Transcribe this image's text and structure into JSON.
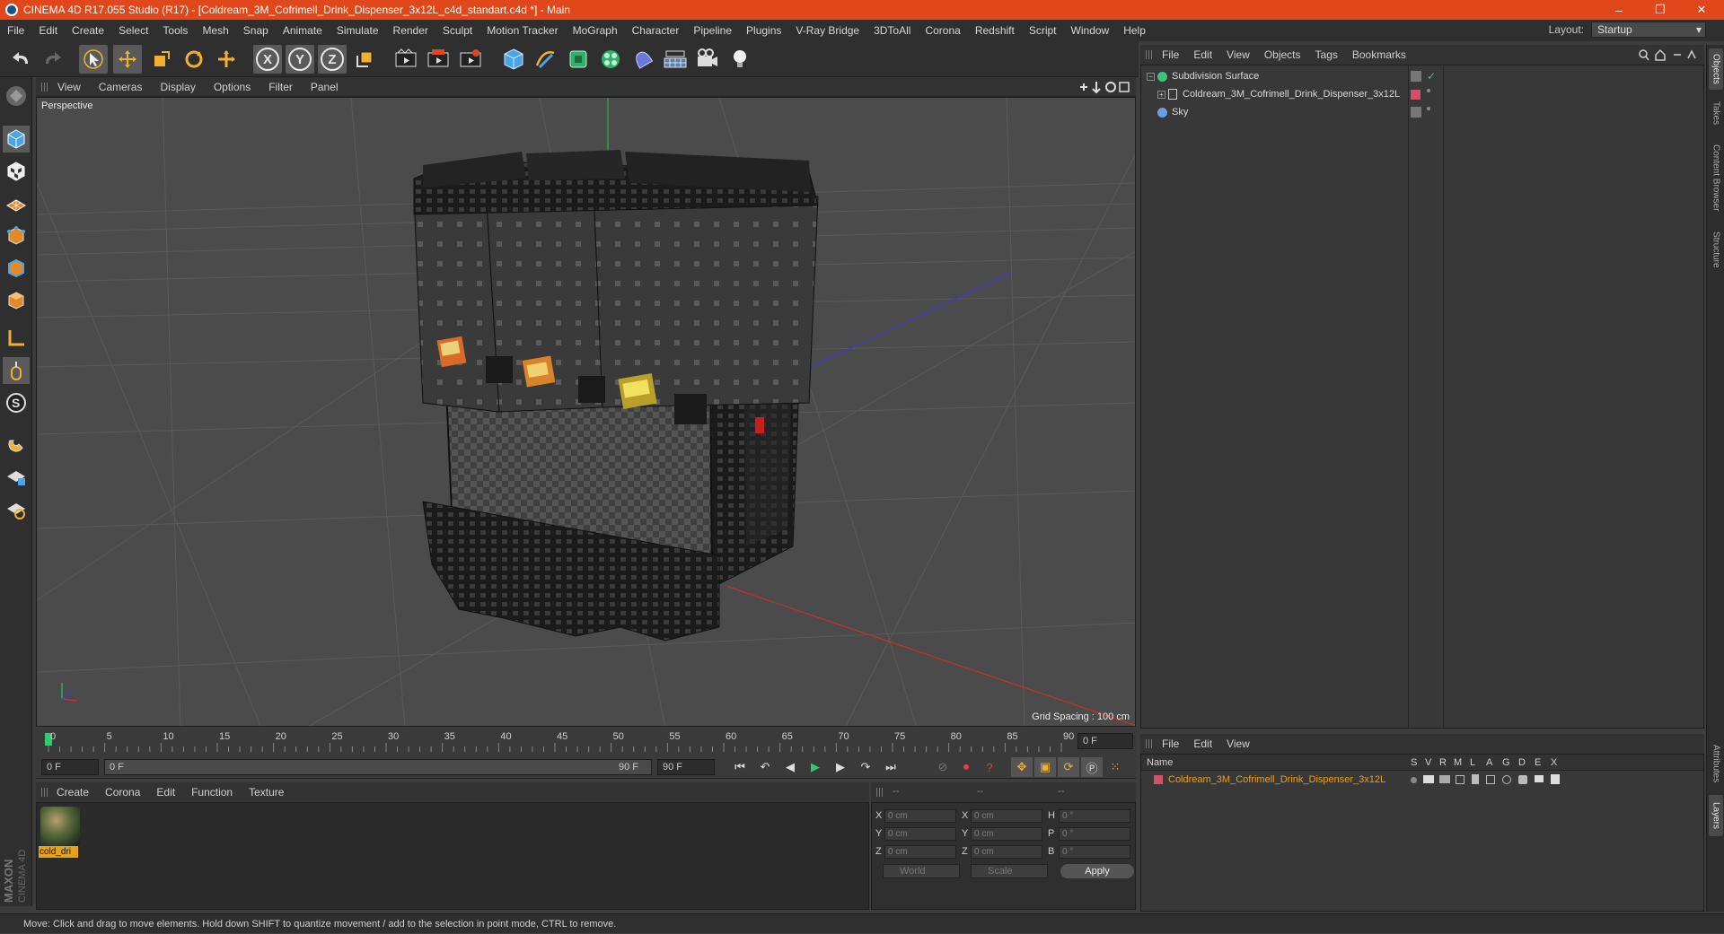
{
  "window": {
    "title": "CINEMA 4D R17.055 Studio (R17) - [Coldream_3M_Cofrimell_Drink_Dispenser_3x12L_c4d_standart.c4d *] - Main",
    "controls": [
      "–",
      "❐",
      "✕"
    ]
  },
  "menubar": {
    "items": [
      "File",
      "Edit",
      "Create",
      "Select",
      "Tools",
      "Mesh",
      "Snap",
      "Animate",
      "Simulate",
      "Render",
      "Sculpt",
      "Motion Tracker",
      "MoGraph",
      "Character",
      "Pipeline",
      "Plugins",
      "V-Ray Bridge",
      "3DToAll",
      "Corona",
      "Redshift",
      "Script",
      "Window",
      "Help"
    ],
    "layout_label": "Layout:",
    "layout_value": "Startup"
  },
  "viewport": {
    "menu": [
      "View",
      "Cameras",
      "Display",
      "Options",
      "Filter",
      "Panel"
    ],
    "label": "Perspective",
    "grid_spacing": "Grid Spacing : 100 cm"
  },
  "timeline": {
    "ticks": [
      "0",
      "5",
      "10",
      "15",
      "20",
      "25",
      "30",
      "35",
      "40",
      "45",
      "50",
      "55",
      "60",
      "65",
      "70",
      "75",
      "80",
      "85",
      "90"
    ],
    "current_frame": "0 F",
    "start_field": "0 F",
    "range_start": "0 F",
    "range_end": "90 F",
    "end_field": "90 F"
  },
  "materials": {
    "menu": [
      "Create",
      "Corona",
      "Edit",
      "Function",
      "Texture"
    ],
    "items": [
      {
        "name": "cold_dri"
      }
    ]
  },
  "coordinates": {
    "header": [
      "--",
      "--",
      "--"
    ],
    "rows": [
      {
        "l1": "X",
        "v1": "0 cm",
        "l2": "X",
        "v2": "0 cm",
        "l3": "H",
        "v3": "0 °"
      },
      {
        "l1": "Y",
        "v1": "0 cm",
        "l2": "Y",
        "v2": "0 cm",
        "l3": "P",
        "v3": "0 °"
      },
      {
        "l1": "Z",
        "v1": "0 cm",
        "l2": "Z",
        "v2": "0 cm",
        "l3": "B",
        "v3": "0 °"
      }
    ],
    "mode": "World",
    "transform": "Scale",
    "apply": "Apply"
  },
  "objects": {
    "menu": [
      "File",
      "Edit",
      "View",
      "Objects",
      "Tags",
      "Bookmarks"
    ],
    "items": [
      {
        "name": "Subdivision Surface",
        "icon": "subdivision-icon",
        "color": "#3cc47c"
      },
      {
        "name": "Coldream_3M_Cofrimell_Drink_Dispenser_3x12L",
        "icon": "polygon-object-icon",
        "color": "#c8c8c8"
      },
      {
        "name": "Sky",
        "icon": "sky-icon",
        "color": "#6e9de0"
      }
    ]
  },
  "layers": {
    "menu": [
      "File",
      "Edit",
      "View"
    ],
    "columns": [
      "Name",
      "S",
      "V",
      "R",
      "M",
      "L",
      "A",
      "G",
      "D",
      "E",
      "X"
    ],
    "items": [
      {
        "name": "Coldream_3M_Cofrimell_Drink_Dispenser_3x12L",
        "color": "#d64f6a"
      }
    ]
  },
  "right_tabs": [
    "Objects",
    "Takes",
    "Content Browser",
    "Structure",
    "Attributes",
    "Layers"
  ],
  "status": "Move: Click and drag to move elements. Hold down SHIFT to quantize movement / add to the selection in point mode, CTRL to remove.",
  "brand": {
    "line1": "MAXON",
    "line2": "CINEMA 4D"
  },
  "colors": {
    "accent": "#e0481c",
    "selection": "#e6a21a",
    "layer": "#d64f6a"
  }
}
